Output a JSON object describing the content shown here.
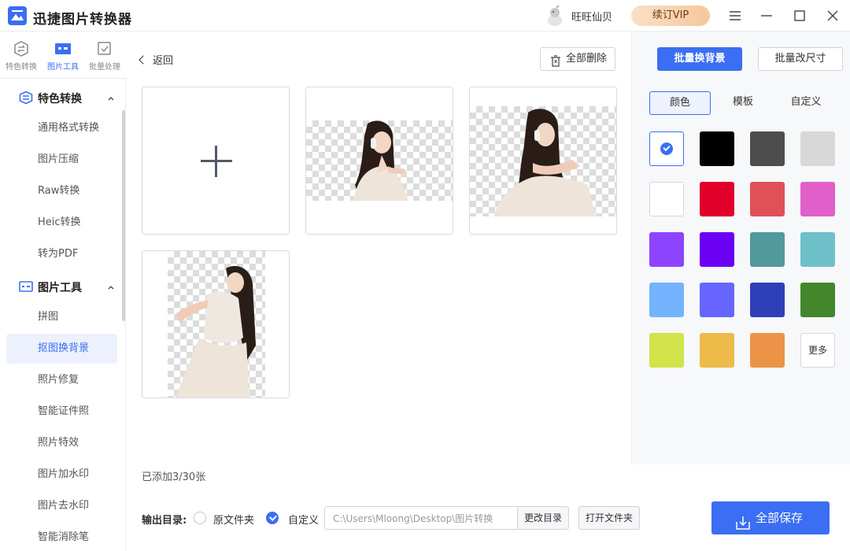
{
  "app": {
    "title": "迅捷图片转换器",
    "username": "旺旺仙贝",
    "vip_label": "续订VIP"
  },
  "icon_tabs": [
    {
      "label": "特色转换"
    },
    {
      "label": "图片工具"
    },
    {
      "label": "批量处理"
    }
  ],
  "sidebar": {
    "section1": {
      "label": "特色转换"
    },
    "section1_items": [
      "通用格式转换",
      "图片压缩",
      "Raw转换",
      "Heic转换",
      "转为PDF"
    ],
    "section2": {
      "label": "图片工具"
    },
    "section2_items": [
      "拼图",
      "抠图换背景",
      "照片修复",
      "智能证件照",
      "照片特效",
      "图片加水印",
      "图片去水印",
      "智能消除笔"
    ],
    "active_item": "抠图换背景"
  },
  "main": {
    "back_label": "返回",
    "delete_all_label": "全部删除",
    "count_text": "已添加3/30张",
    "output_label": "输出目录:",
    "radio_original": "原文件夹",
    "radio_custom": "自定义",
    "output_path": "C:\\Users\\Mloong\\Desktop\\图片转换",
    "change_dir_label": "更改目录",
    "open_folder_label": "打开文件夹",
    "save_all_label": "全部保存"
  },
  "panel": {
    "batch_bg_label": "批量换背景",
    "batch_resize_label": "批量改尺寸",
    "tabs": [
      "颜色",
      "模板",
      "自定义"
    ],
    "active_tab": "颜色",
    "more_label": "更多",
    "selected_swatch": "transparent",
    "colors": [
      "#000000",
      "#4d4d4d",
      "#d8d8d8",
      "#ffffff",
      "#e0002a",
      "#e05058",
      "#e05fc8",
      "#8c44ff",
      "#6a00f4",
      "#52999c",
      "#6ec1c9",
      "#74b4ff",
      "#6666ff",
      "#2f3fba",
      "#43862c",
      "#d3e34a",
      "#ecbb4a",
      "#eb9447"
    ]
  }
}
